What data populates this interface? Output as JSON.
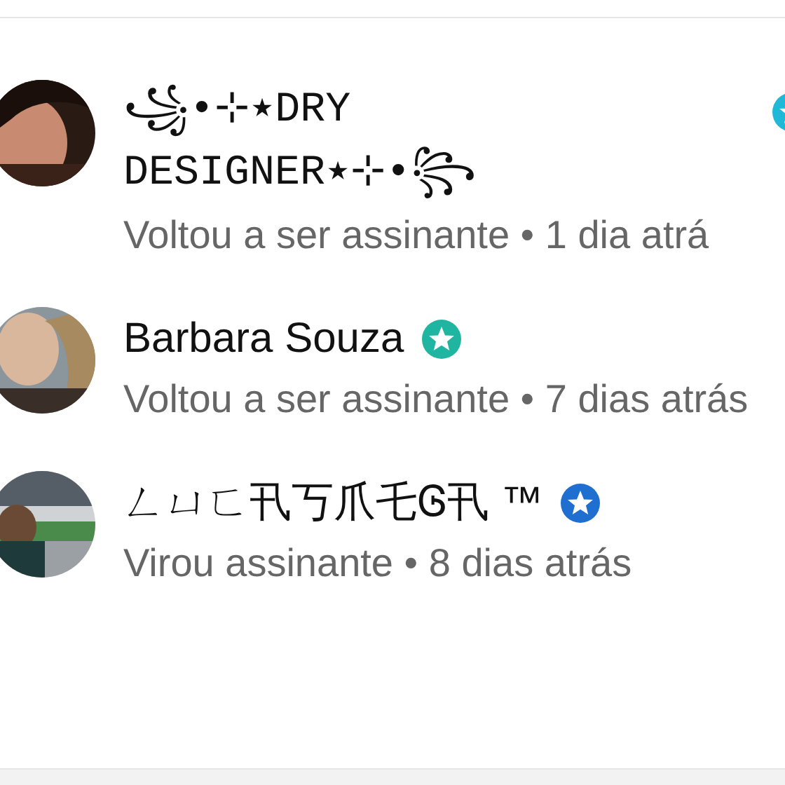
{
  "subscribers": [
    {
      "name": "꧁•⊹٭DRY DESIGNER٭⊹•꧂",
      "badge": {
        "color": "#1fb8d6"
      },
      "status": "Voltou a ser assinante • 1 dia atrá"
    },
    {
      "name": "Barbara Souza",
      "badge": {
        "color": "#1fb5a0"
      },
      "status": "Voltou a ser assinante • 7 dias atrás"
    },
    {
      "name": "ㄥㄩㄈ卂丂爪乇Ꮆ卂 ™",
      "badge": {
        "color": "#1e6fd0"
      },
      "status": "Virou assinante • 8 dias atrás"
    }
  ]
}
